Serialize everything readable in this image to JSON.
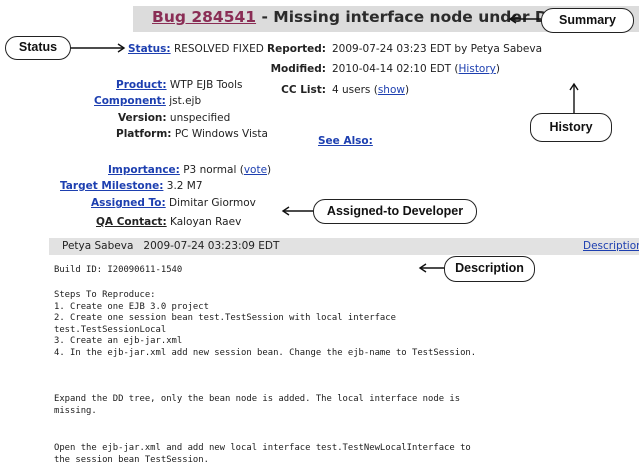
{
  "bug": {
    "id_label": "Bug 284541",
    "summary": " - Missing interface node under DD tree"
  },
  "fields": {
    "status_label": "Status:",
    "status_value": " RESOLVED FIXED",
    "product_label": "Product:",
    "product_value": " WTP EJB Tools",
    "component_label": "Component:",
    "component_value": " jst.ejb",
    "version_label": "Version:",
    "version_value": " unspecified",
    "platform_label": "Platform:",
    "platform_value": " PC Windows Vista",
    "importance_label": "Importance:",
    "importance_value": " P3 normal (",
    "vote_link": "vote",
    "importance_close": ")",
    "milestone_label": "Target Milestone:",
    "milestone_value": " 3.2 M7",
    "assigned_label": "Assigned To:",
    "assigned_value": " Dimitar Giormov",
    "qa_label": "QA Contact:",
    "qa_value": " Kaloyan Raev"
  },
  "right_fields": {
    "reported_label": "Reported:",
    "reported_value": "2009-07-24 03:23 EDT by Petya Sabeva",
    "modified_label": "Modified:",
    "modified_value": "2010-04-14 02:10 EDT (",
    "history_link": "History",
    "modified_close": ")",
    "cc_label": "CC List:",
    "cc_value": "4 users (",
    "show_link": "show",
    "cc_close": ")",
    "see_also_label": "See Also:"
  },
  "callouts": {
    "summary": "Summary",
    "status": "Status",
    "history": "History",
    "assigned": "Assigned-to Developer",
    "description": "Description"
  },
  "description": {
    "author": "Petya Sabeva",
    "timestamp": "2009-07-24 03:23:09 EDT",
    "link": "Description",
    "build_id": "Build ID: I20090611-1540",
    "steps": "Steps To Reproduce:\n1. Create one EJB 3.0 project\n2. Create one session bean test.TestSession with local interface\ntest.TestSessionLocal\n3. Create an ejb-jar.xml\n4. In the ejb-jar.xml add new session bean. Change the ejb-name to TestSession.",
    "expand": "Expand the DD tree, only the bean node is added. The local interface node is\nmissing.",
    "open": "Open the ejb-jar.xml and add new local interface test.TestNewLocalInterface to\nthe session bean TestSession."
  }
}
